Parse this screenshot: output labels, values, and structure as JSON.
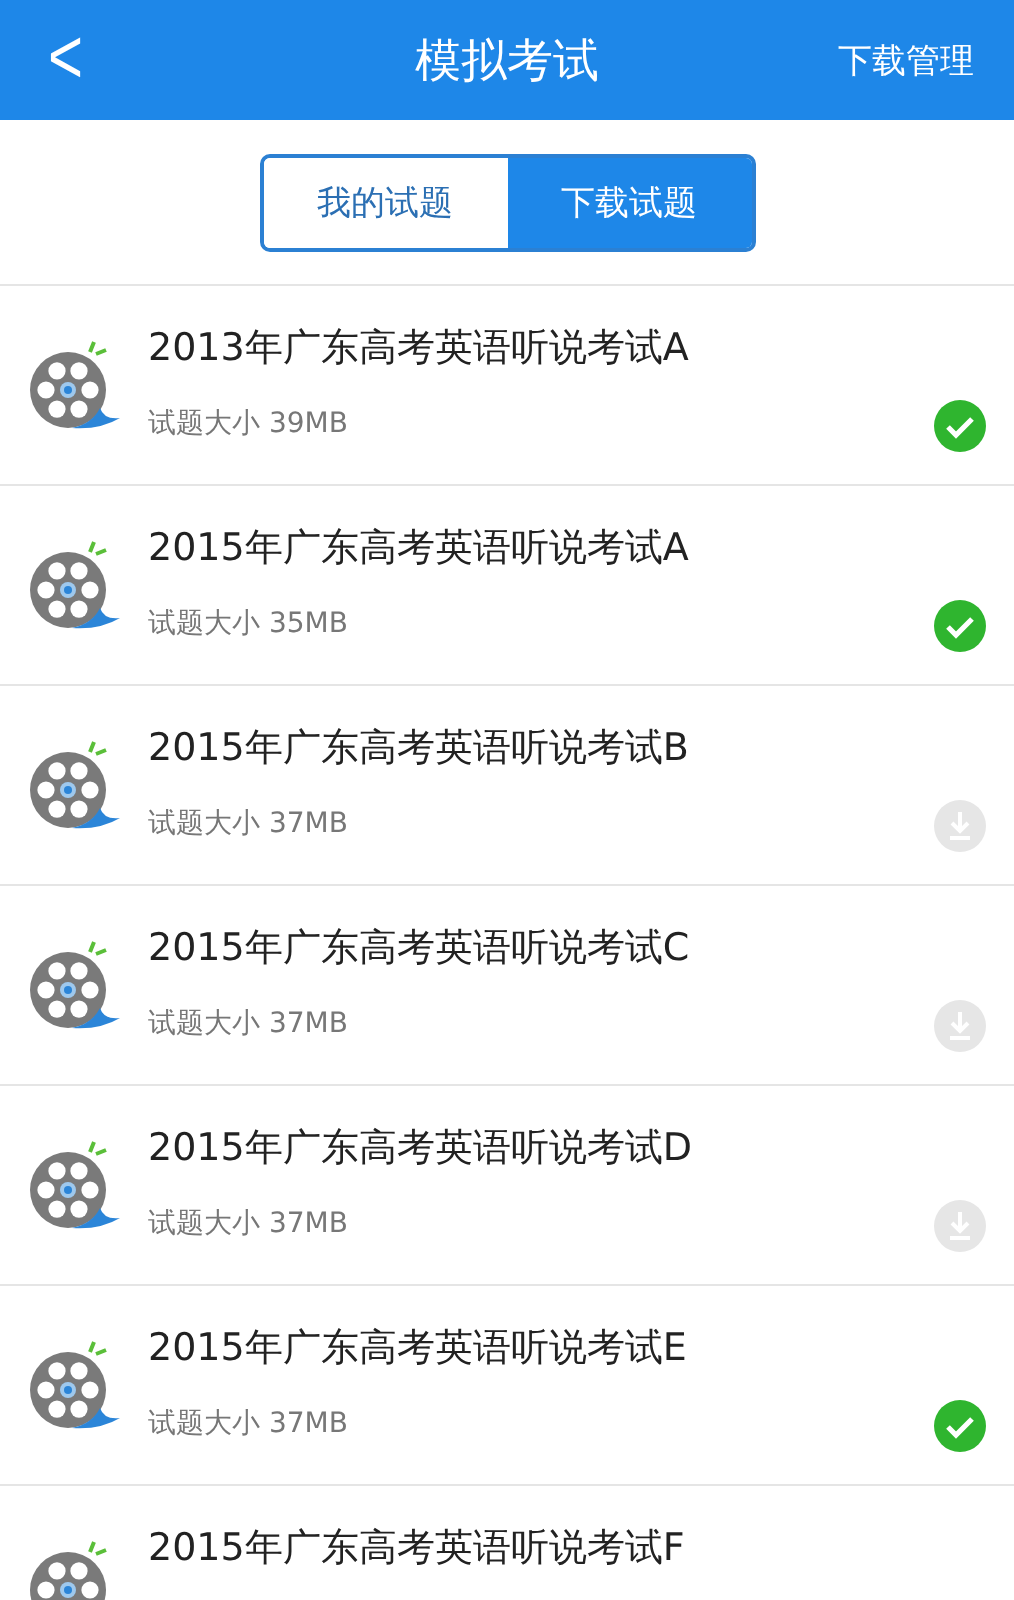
{
  "header": {
    "back": "<",
    "title": "模拟考试",
    "action": "下载管理"
  },
  "tabs": [
    {
      "label": "我的试题",
      "selected": false
    },
    {
      "label": "下载试题",
      "selected": true
    }
  ],
  "exams": [
    {
      "title": "2013年广东高考英语听说考试A",
      "size": "试题大小 39MB",
      "downloaded": true
    },
    {
      "title": "2015年广东高考英语听说考试A",
      "size": "试题大小 35MB",
      "downloaded": true
    },
    {
      "title": "2015年广东高考英语听说考试B",
      "size": "试题大小 37MB",
      "downloaded": false
    },
    {
      "title": "2015年广东高考英语听说考试C",
      "size": "试题大小 37MB",
      "downloaded": false
    },
    {
      "title": "2015年广东高考英语听说考试D",
      "size": "试题大小 37MB",
      "downloaded": false
    },
    {
      "title": "2015年广东高考英语听说考试E",
      "size": "试题大小 37MB",
      "downloaded": true
    },
    {
      "title": "2015年广东高考英语听说考试F"
    }
  ]
}
